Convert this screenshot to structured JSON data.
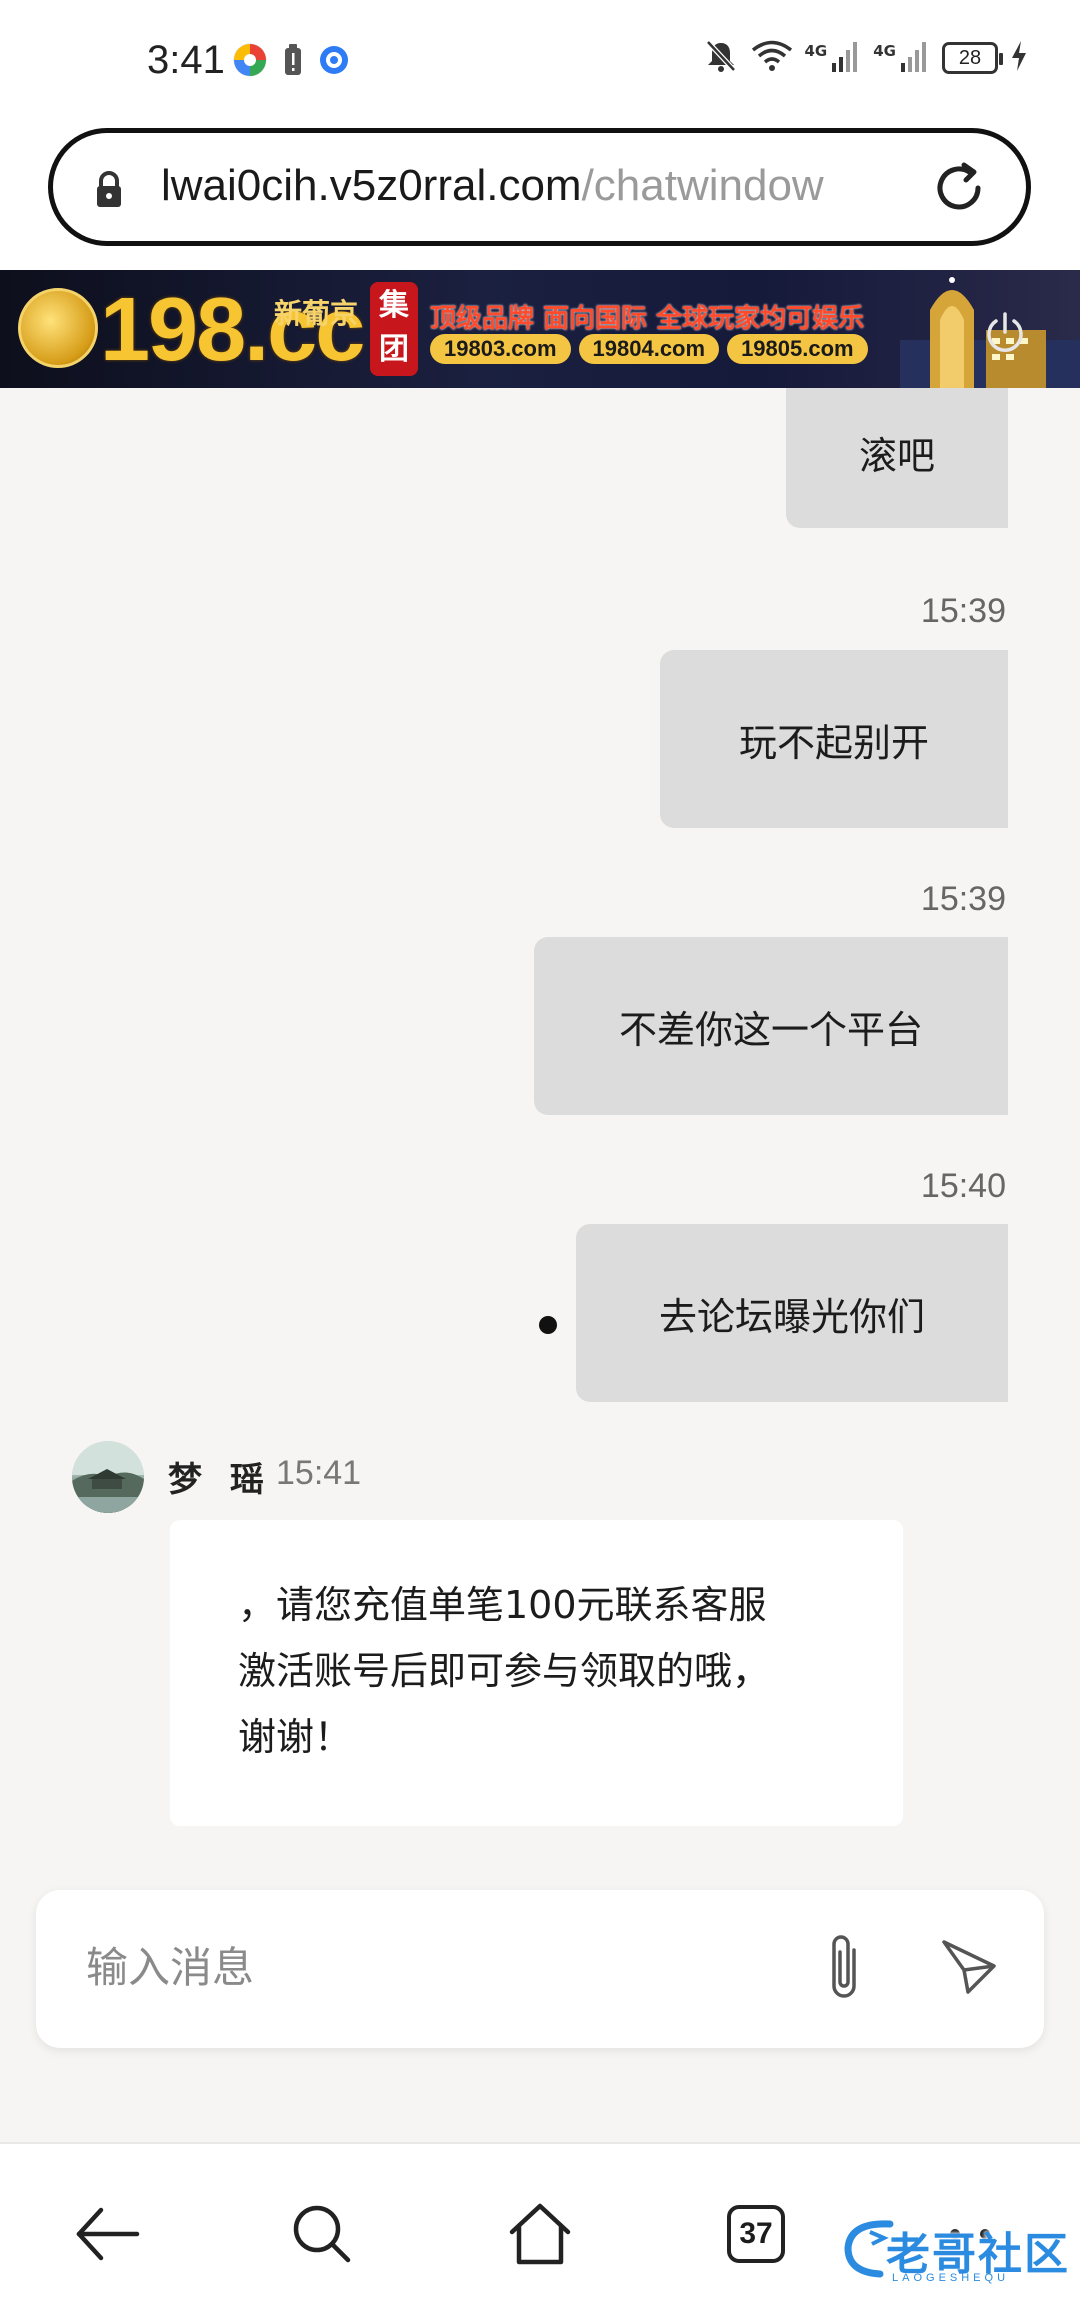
{
  "status_bar": {
    "time": "3:41",
    "network_1": "4G",
    "network_2": "4G",
    "battery": "28"
  },
  "browser": {
    "url_host": "lwai0cih.v5z0rral.com",
    "url_path": "/chatwindow",
    "tab_count": "37"
  },
  "ad": {
    "brand": "198.cc",
    "sub_brand": "新葡京",
    "group_label": "集团",
    "slogan": "顶级品牌 面向国际 全球玩家均可娱乐",
    "domains": [
      "19803.com",
      "19804.com",
      "19805.com"
    ]
  },
  "chat": {
    "outgoing": [
      {
        "text": "滚吧",
        "time": ""
      },
      {
        "text": "玩不起别开",
        "time": "15:39"
      },
      {
        "text": "不差你这一个平台",
        "time": "15:39"
      },
      {
        "text": "去论坛曝光你们",
        "time": "15:40"
      }
    ],
    "incoming": {
      "sender": "梦 瑶",
      "time": "15:41",
      "lines": [
        "，请您充值单笔100元联系客服",
        "激活账号后即可参与领取的哦，",
        "谢谢！"
      ]
    }
  },
  "composer": {
    "placeholder": "输入消息"
  },
  "watermark": {
    "text": "老哥社区",
    "sub": "LAOGESHEQU"
  },
  "colors": {
    "page_bg": "#f6f5f3",
    "outgoing_bubble": "#dcdcdc",
    "incoming_bubble": "#ffffff",
    "ad_gold": "#f7c531",
    "ad_red": "#c8161d",
    "watermark_blue": "#2a8be0"
  },
  "icons": [
    "lock-icon",
    "reload-icon",
    "power-icon",
    "paperclip-icon",
    "send-icon",
    "back-arrow-icon",
    "search-icon",
    "home-icon",
    "more-icon",
    "mute-icon",
    "wifi-icon",
    "signal-icon",
    "charging-icon"
  ]
}
